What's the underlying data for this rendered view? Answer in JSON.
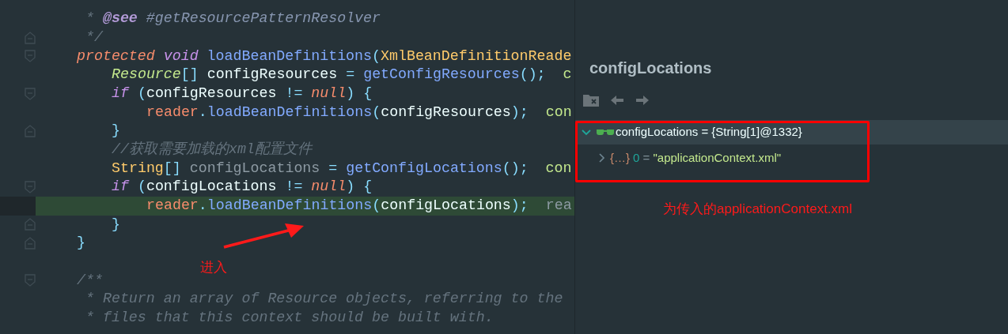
{
  "editor": {
    "lines": [
      {
        "kind": "doc",
        "tokens": [
          {
            "text": "* ",
            "kind": "comment"
          },
          {
            "text": "@see",
            "kind": "doctag"
          },
          {
            "text": " #getResourcePatternResolver",
            "kind": "doclink"
          }
        ]
      },
      {
        "kind": "doc",
        "fold_close": true,
        "tokens": [
          {
            "text": "*/",
            "kind": "comment"
          }
        ]
      },
      {
        "kind": "top",
        "fold_open": true,
        "tokens": [
          {
            "text": "protected",
            "kind": "modifier"
          },
          {
            "text": " void",
            "kind": "keyword"
          },
          {
            "text": " loadBeanDefinitions",
            "kind": "method"
          },
          {
            "text": "(",
            "kind": "punct"
          },
          {
            "text": "XmlBeanDefinitionReade",
            "kind": "class"
          }
        ]
      },
      {
        "kind": "body",
        "tokens": [
          {
            "text": "Resource",
            "kind": "type"
          },
          {
            "text": "[]",
            "kind": "punct"
          },
          {
            "text": " configResources ",
            "kind": "plain"
          },
          {
            "text": "=",
            "kind": "punct"
          },
          {
            "text": " getConfigResources",
            "kind": "method"
          },
          {
            "text": "();",
            "kind": "punct"
          },
          {
            "text": "  c",
            "kind": "hint"
          }
        ]
      },
      {
        "kind": "body",
        "fold_open": true,
        "tokens": [
          {
            "text": "if",
            "kind": "keyword"
          },
          {
            "text": " (",
            "kind": "punct"
          },
          {
            "text": "configResources ",
            "kind": "plain"
          },
          {
            "text": "!=",
            "kind": "punct"
          },
          {
            "text": " null",
            "kind": "null"
          },
          {
            "text": ") {",
            "kind": "punct"
          }
        ]
      },
      {
        "kind": "nested",
        "tokens": [
          {
            "text": "reader",
            "kind": "field"
          },
          {
            "text": ".",
            "kind": "punct"
          },
          {
            "text": "loadBeanDefinitions",
            "kind": "method"
          },
          {
            "text": "(",
            "kind": "punct"
          },
          {
            "text": "configResources",
            "kind": "plain"
          },
          {
            "text": ");",
            "kind": "punct"
          },
          {
            "text": "  con",
            "kind": "hint"
          }
        ]
      },
      {
        "kind": "body",
        "fold_close": true,
        "tokens": [
          {
            "text": "}",
            "kind": "punct"
          }
        ]
      },
      {
        "kind": "body",
        "tokens": [
          {
            "text": "//获取需要加载的xml配置文件",
            "kind": "comment"
          }
        ]
      },
      {
        "kind": "body",
        "tokens": [
          {
            "text": "String",
            "kind": "class"
          },
          {
            "text": "[]",
            "kind": "punct"
          },
          {
            "text": " configLocations ",
            "kind": "unused"
          },
          {
            "text": "=",
            "kind": "punct"
          },
          {
            "text": " getConfigLocations",
            "kind": "method"
          },
          {
            "text": "();",
            "kind": "punct"
          },
          {
            "text": "  con",
            "kind": "hint"
          }
        ]
      },
      {
        "kind": "body",
        "fold_open": true,
        "tokens": [
          {
            "text": "if",
            "kind": "keyword"
          },
          {
            "text": " (",
            "kind": "punct"
          },
          {
            "text": "configLocations ",
            "kind": "plain"
          },
          {
            "text": "!=",
            "kind": "punct"
          },
          {
            "text": " null",
            "kind": "null"
          },
          {
            "text": ") {",
            "kind": "punct"
          }
        ]
      },
      {
        "kind": "nested",
        "highlighted": true,
        "tokens": [
          {
            "text": "reader",
            "kind": "field"
          },
          {
            "text": ".",
            "kind": "punct"
          },
          {
            "text": "loadBeanDefinitions",
            "kind": "method"
          },
          {
            "text": "(",
            "kind": "punct"
          },
          {
            "text": "configLocations",
            "kind": "plain"
          },
          {
            "text": ");",
            "kind": "punct"
          },
          {
            "text": "  rea",
            "kind": "hint_muted"
          }
        ]
      },
      {
        "kind": "body",
        "fold_close": true,
        "tokens": [
          {
            "text": "}",
            "kind": "punct"
          }
        ]
      },
      {
        "kind": "top",
        "fold_close": true,
        "tokens": [
          {
            "text": "}",
            "kind": "punct"
          }
        ]
      },
      {
        "kind": "blank"
      },
      {
        "kind": "top",
        "fold_open": true,
        "tokens": [
          {
            "text": "/**",
            "kind": "comment"
          }
        ]
      },
      {
        "kind": "doc",
        "tokens": [
          {
            "text": "* Return an array of Resource objects, referring to the",
            "kind": "comment"
          }
        ]
      },
      {
        "kind": "doc",
        "tokens": [
          {
            "text": "* files that this context should be built with.",
            "kind": "comment"
          }
        ]
      }
    ]
  },
  "debug_popup": {
    "title": "configLocations",
    "tree": [
      {
        "kind": "watch",
        "expanded": true,
        "selected": true,
        "name": "configLocations",
        "separator": " = ",
        "value": "{String[1]@1332}",
        "children": [
          {
            "kind": "element",
            "expanded": false,
            "selected": false,
            "badge": "{…}",
            "name": "0",
            "separator": " = ",
            "value": "\"applicationContext.xml\""
          }
        ]
      }
    ]
  },
  "annotations": [
    {
      "kind": "box-note",
      "text": "为传入的applicationContext.xml"
    },
    {
      "kind": "arrow-note",
      "text": "进入"
    }
  ]
}
